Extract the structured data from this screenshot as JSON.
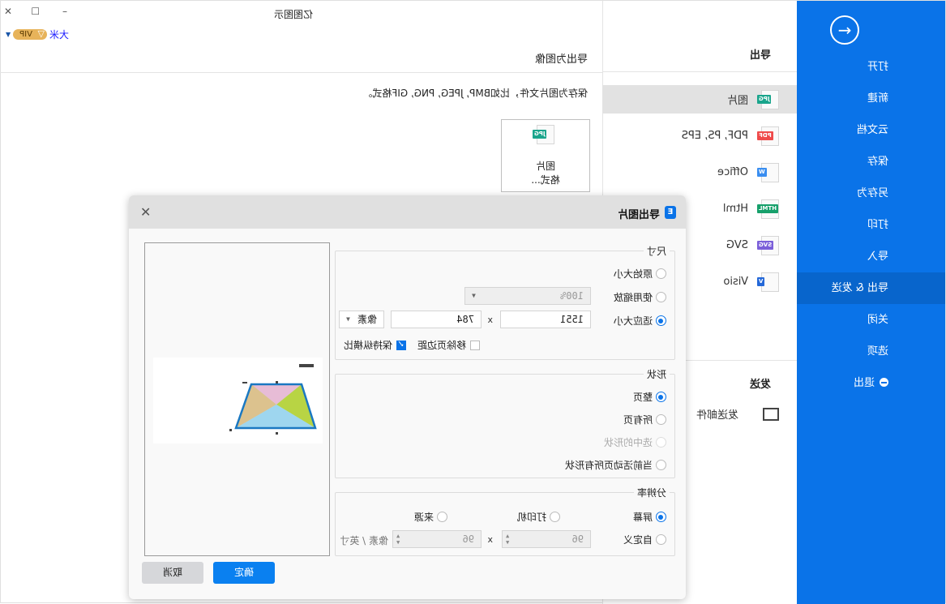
{
  "window": {
    "title": "亿图图示",
    "controls": [
      "minimize",
      "maximize",
      "close"
    ],
    "user": {
      "name": "大米",
      "badge": "VIP"
    }
  },
  "sidebar": {
    "back_icon": "arrow-right-circle-icon",
    "items": [
      {
        "label": "打开"
      },
      {
        "label": "新建"
      },
      {
        "label": "云文档"
      },
      {
        "label": "保存"
      },
      {
        "label": "另存为"
      },
      {
        "label": "打印"
      },
      {
        "label": "导入"
      },
      {
        "label": "导出 & 发送",
        "active": true
      },
      {
        "label": "关闭"
      },
      {
        "label": "选项"
      },
      {
        "label": "退出"
      }
    ]
  },
  "export_panel": {
    "header": "导出",
    "items": [
      {
        "label": "图片",
        "tag": "JPG",
        "color": "#1aa58c",
        "active": true
      },
      {
        "label": "PDF, PS, EPS",
        "tag": "PDF",
        "color": "#ef4a4a"
      },
      {
        "label": "Office",
        "tag": "W",
        "color": "#3a8ef0"
      },
      {
        "label": "Html",
        "tag": "HTML",
        "color": "#17a06b"
      },
      {
        "label": "SVG",
        "tag": "SVG",
        "color": "#7b5fd9"
      },
      {
        "label": "Visio",
        "tag": "V",
        "color": "#2468d8"
      }
    ],
    "send_header": "发送",
    "send_items": [
      {
        "label": "发送邮件"
      }
    ]
  },
  "content": {
    "title": "导出为图像",
    "description": "保存为图片文件，比如BMP, JPEG, PNG, GIF格式。",
    "card": {
      "tag": "JPG",
      "line1": "图片",
      "line2": "格式..."
    }
  },
  "dialog": {
    "title": "导出图片",
    "size_group": {
      "legend": "尺寸",
      "options": [
        "原始大小",
        "使用缩放",
        "适应大小"
      ],
      "selected": "适应大小",
      "zoom_value": "100%",
      "width": "1551",
      "height": "784",
      "unit": "像素",
      "x_label": "x",
      "keep_ratio": {
        "label": "保持纵横比",
        "checked": true
      },
      "remove_margin": {
        "label": "移除页边距",
        "checked": false
      }
    },
    "shape_group": {
      "legend": "形状",
      "options": [
        "整页",
        "所有页",
        "选中的形状",
        "当前活动页所有形状"
      ],
      "selected": "整页",
      "disabled": [
        "选中的形状"
      ]
    },
    "resolution_group": {
      "legend": "分辨率",
      "options": [
        "屏幕",
        "打印机",
        "来源",
        "自定义"
      ],
      "selected": "屏幕",
      "dpi_x": "96",
      "dpi_y": "96",
      "x_label": "x",
      "unit": "像素 / 英寸"
    },
    "ok_label": "确定",
    "cancel_label": "取消"
  },
  "colors": {
    "accent": "#0a73e8",
    "sidebar_active": "#0865cc",
    "ok_button": "#0a80f0"
  }
}
